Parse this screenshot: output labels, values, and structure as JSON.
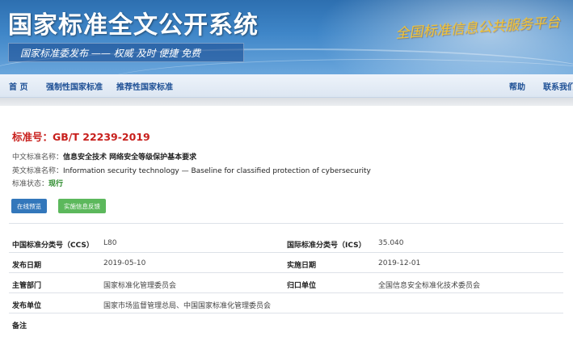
{
  "header": {
    "site_title": "国家标准全文公开系统",
    "slogan": "国家标准委发布 —— 权威 及时 便捷 免费",
    "tagline": "全国标准信息公共服务平台"
  },
  "nav": {
    "home": "首 页",
    "mandatory": "强制性国家标准",
    "recommended": "推荐性国家标准",
    "help": "帮助",
    "contact": "联系我们"
  },
  "standard": {
    "number_label": "标准号：",
    "number": "GB/T 22239-2019",
    "cn_name_label": "中文标准名称：",
    "cn_name": "信息安全技术 网络安全等级保护基本要求",
    "en_name_label": "英文标准名称：",
    "en_name": "Information security technology — Baseline for classified protection of cybersecurity",
    "status_label": "标准状态：",
    "status": "现行"
  },
  "buttons": {
    "preview": "在线预览",
    "feedback": "实施信息反馈"
  },
  "details": {
    "ccs_label": "中国标准分类号（CCS）",
    "ccs": "L80",
    "ics_label": "国际标准分类号（ICS）",
    "ics": "35.040",
    "publish_date_label": "发布日期",
    "publish_date": "2019-05-10",
    "impl_date_label": "实施日期",
    "impl_date": "2019-12-01",
    "dept_label": "主管部门",
    "dept": "国家标准化管理委员会",
    "central_label": "归口单位",
    "central": "全国信息安全标准化技术委员会",
    "issuer_label": "发布单位",
    "issuer": "国家市场监督管理总局、中国国家标准化管理委员会",
    "remarks_label": "备注",
    "remarks": ""
  },
  "colors": {
    "banner": "#3f86c8",
    "nav_text": "#1d4f95",
    "std_number": "#c8201d",
    "status": "#2a8a2a",
    "preview_button": "#3377bb",
    "feedback_button": "#5cb85c"
  }
}
